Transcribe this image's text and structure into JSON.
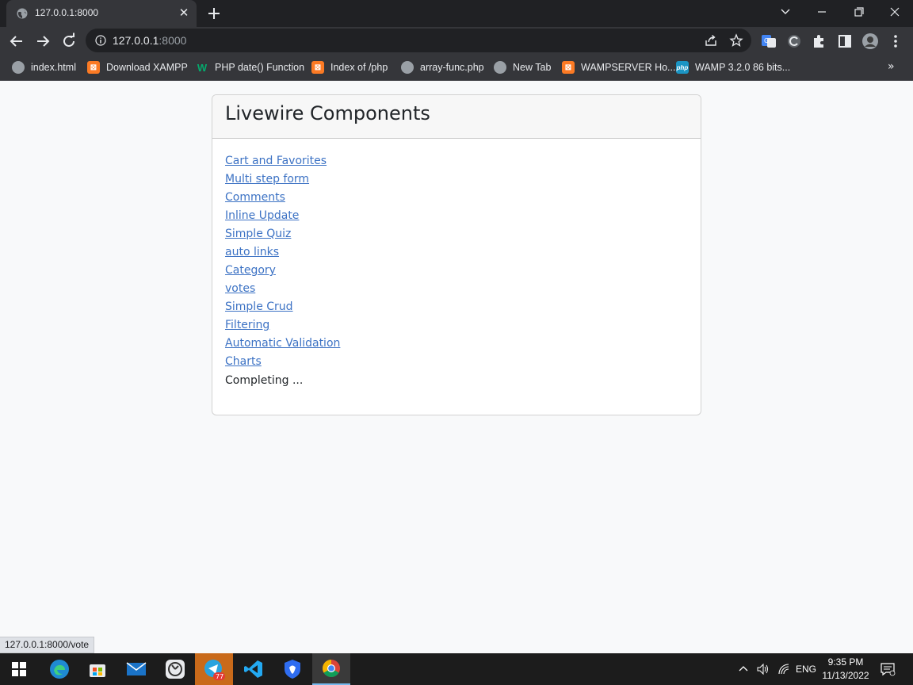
{
  "browser": {
    "tab_title": "127.0.0.1:8000",
    "url_host": "127.0.0.1",
    "url_port": ":8000",
    "bookmarks": [
      {
        "label": "index.html",
        "icon": "globe-icon"
      },
      {
        "label": "Download XAMPP",
        "icon": "xampp-icon"
      },
      {
        "label": "PHP date() Function",
        "icon": "w3schools-icon"
      },
      {
        "label": "Index of /php",
        "icon": "xampp-icon"
      },
      {
        "label": "array-func.php",
        "icon": "globe-icon"
      },
      {
        "label": "New Tab",
        "icon": "globe-icon"
      },
      {
        "label": "WAMPSERVER Ho...",
        "icon": "xampp-icon"
      },
      {
        "label": "WAMP 3.2.0 86 bits...",
        "icon": "php-icon"
      }
    ],
    "status_url": "127.0.0.1:8000/vote"
  },
  "page": {
    "card_title": "Livewire Components",
    "links": [
      "Cart and Favorites",
      "Multi step form",
      "Comments",
      "Inline Update",
      "Simple Quiz",
      "auto links",
      "Category",
      "votes",
      "Simple Crud",
      "Filtering",
      "Automatic Validation",
      "Charts"
    ],
    "status_text": "Completing ..."
  },
  "taskbar": {
    "telegram_badge": "77",
    "language": "ENG",
    "time": "9:35 PM",
    "date": "11/13/2022"
  },
  "colors": {
    "link": "#3c72c4",
    "chrome_dark": "#202124",
    "chrome_toolbar": "#35363a",
    "page_bg": "#f8f9fa"
  }
}
